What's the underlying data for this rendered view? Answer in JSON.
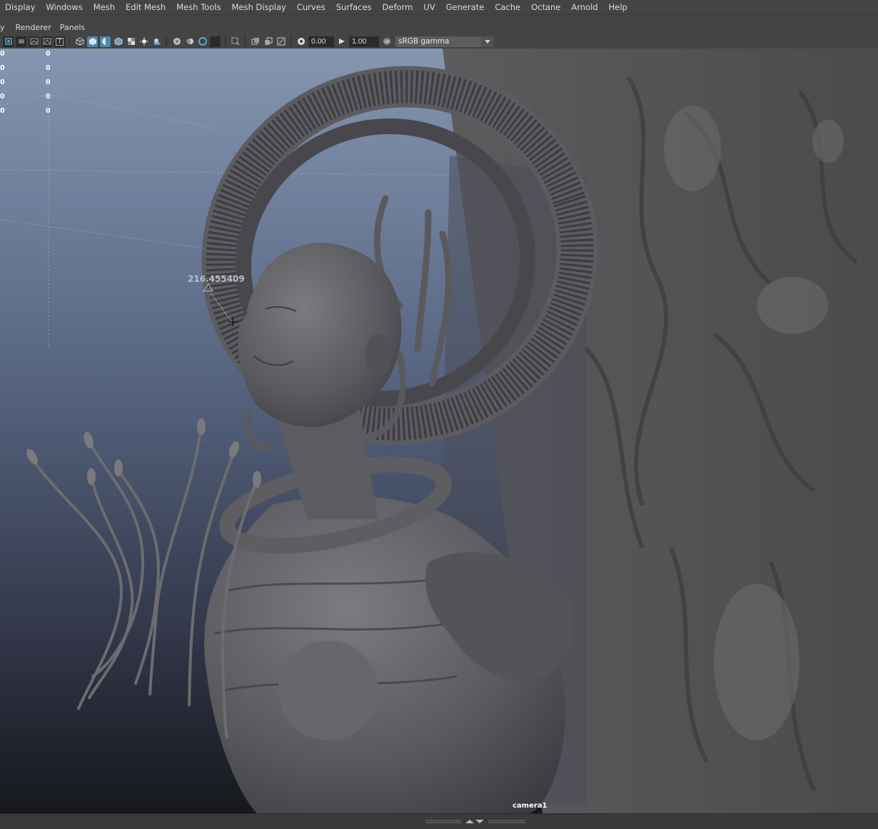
{
  "menubar": {
    "items": [
      "Display",
      "Windows",
      "Mesh",
      "Edit Mesh",
      "Mesh Tools",
      "Mesh Display",
      "Curves",
      "Surfaces",
      "Deform",
      "UV",
      "Generate",
      "Cache",
      "Octane",
      "Arnold",
      "Help"
    ]
  },
  "panelbar": {
    "leading": "y",
    "items": [
      "Renderer",
      "Panels"
    ]
  },
  "toolbar": {
    "exposure_value": "0.00",
    "gamma_value": "1.00",
    "colorspace_selected": "sRGB gamma"
  },
  "hud": {
    "rows": [
      {
        "left": "0",
        "right": "0"
      },
      {
        "left": "0",
        "right": "0"
      },
      {
        "left": "0",
        "right": "0"
      },
      {
        "left": "0",
        "right": "0"
      },
      {
        "left": "0",
        "right": "0"
      }
    ]
  },
  "viewport": {
    "measure_value": "216.455409",
    "camera_label": "camera1",
    "bg_top_color": "#8596b0",
    "bg_bottom_color": "#16181d",
    "mesh_color": "#56565a"
  }
}
